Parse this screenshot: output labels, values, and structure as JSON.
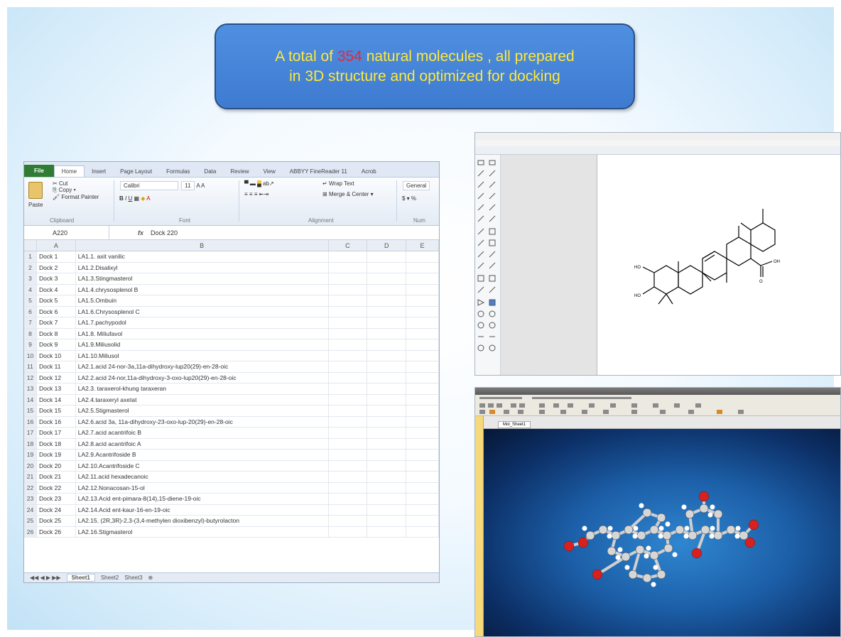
{
  "slide": {
    "title_prefix": "A total of ",
    "title_number": "354",
    "title_suffix": " natural molecules , all prepared",
    "title_line2": "in 3D structure and optimized for docking",
    "number_color": "#e8283a",
    "text_color": "#ffe83a"
  },
  "excel": {
    "tabs": [
      "File",
      "Home",
      "Insert",
      "Page Layout",
      "Formulas",
      "Data",
      "Review",
      "View",
      "ABBYY FineReader 11",
      "Acrob"
    ],
    "ribbon": {
      "cut": "Cut",
      "copy": "Copy",
      "paste": "Paste",
      "format_painter": "Format Painter",
      "clipboard": "Clipboard",
      "font_name": "Calibri",
      "font_size": "11",
      "font_group": "Font",
      "wrap_text": "Wrap Text",
      "merge_center": "Merge & Center",
      "alignment": "Alignment",
      "number_format": "General",
      "number_group": "Num"
    },
    "name_box": "A220",
    "formula": "Dock 220",
    "columns": [
      "A",
      "B",
      "C",
      "D",
      "E"
    ],
    "rows": [
      [
        "1",
        "Dock 1",
        "LA1.1. axit vanilic"
      ],
      [
        "2",
        "Dock 2",
        "LA1.2.Disalixyl"
      ],
      [
        "3",
        "Dock 3",
        "LA1.3.Stingmasterol"
      ],
      [
        "4",
        "Dock 4",
        "LA1.4.chrysosplenol B"
      ],
      [
        "5",
        "Dock 5",
        "LA1.5.Ombuin"
      ],
      [
        "6",
        "Dock 6",
        "LA1.6.Chrysosplenol C"
      ],
      [
        "7",
        "Dock 7",
        "LA1.7.pachypodol"
      ],
      [
        "8",
        "Dock 8",
        "LA1.8. Miliufavol"
      ],
      [
        "9",
        "Dock 9",
        "LA1.9.Miliusolid"
      ],
      [
        "10",
        "Dock 10",
        "LA1.10.Miliusol"
      ],
      [
        "11",
        "Dock 11",
        "LA2.1.acid 24-nor-3a,11a-dihydroxy-lup20(29)-en-28-oic"
      ],
      [
        "12",
        "Dock 12",
        "LA2.2.acid 24-nor,11a-dihydroxy-3-oxo-lup20(29)-en-28-oic"
      ],
      [
        "13",
        "Dock 13",
        "LA2.3. taraxerol-khung taraxeran"
      ],
      [
        "14",
        "Dock 14",
        "LA2.4.taraxeryl axetat"
      ],
      [
        "15",
        "Dock 15",
        "LA2.5.Stigmasterol"
      ],
      [
        "16",
        "Dock 16",
        "LA2.6.acid 3a, 11a-dihydroxy-23-oxo-lup-20(29)-en-28-oic"
      ],
      [
        "17",
        "Dock 17",
        "LA2.7.acid acantrifoic B"
      ],
      [
        "18",
        "Dock 18",
        "LA2.8.acid acantrifoic A"
      ],
      [
        "19",
        "Dock 19",
        "LA2.9.Acantrifoside B"
      ],
      [
        "20",
        "Dock 20",
        "LA2.10.Acantrifoside C"
      ],
      [
        "21",
        "Dock 21",
        "LA2.11.acid hexadecanoic"
      ],
      [
        "22",
        "Dock 22",
        "LA2.12.Nonacosan-15-ol"
      ],
      [
        "23",
        "Dock 23",
        "LA2.13.Acid ent-pimara-8(14),15-diene-19-oic"
      ],
      [
        "24",
        "Dock 24",
        "LA2.14.Acid ent-kaur-16-en-19-oic"
      ],
      [
        "25",
        "Dock 25",
        "LA2.15. (2R,3R)-2,3-(3,4-methylen dioxibenzyl)-butyrolacton"
      ],
      [
        "26",
        "Dock 26",
        "LA2.16.Stigmasterol"
      ]
    ],
    "sheets": [
      "Sheet1",
      "Sheet2",
      "Sheet3"
    ]
  },
  "chemdraw": {
    "atom_labels": [
      "OH",
      "HO",
      "HO",
      "O"
    ],
    "bond_color": "#000000"
  },
  "viewer": {
    "tab_label": "Mol_Sheet1",
    "bg_color": "#1c5fa8",
    "atom_carbon": "#d6d6d6",
    "atom_oxygen": "#d82020",
    "atom_hydrogen": "#ffffff"
  }
}
